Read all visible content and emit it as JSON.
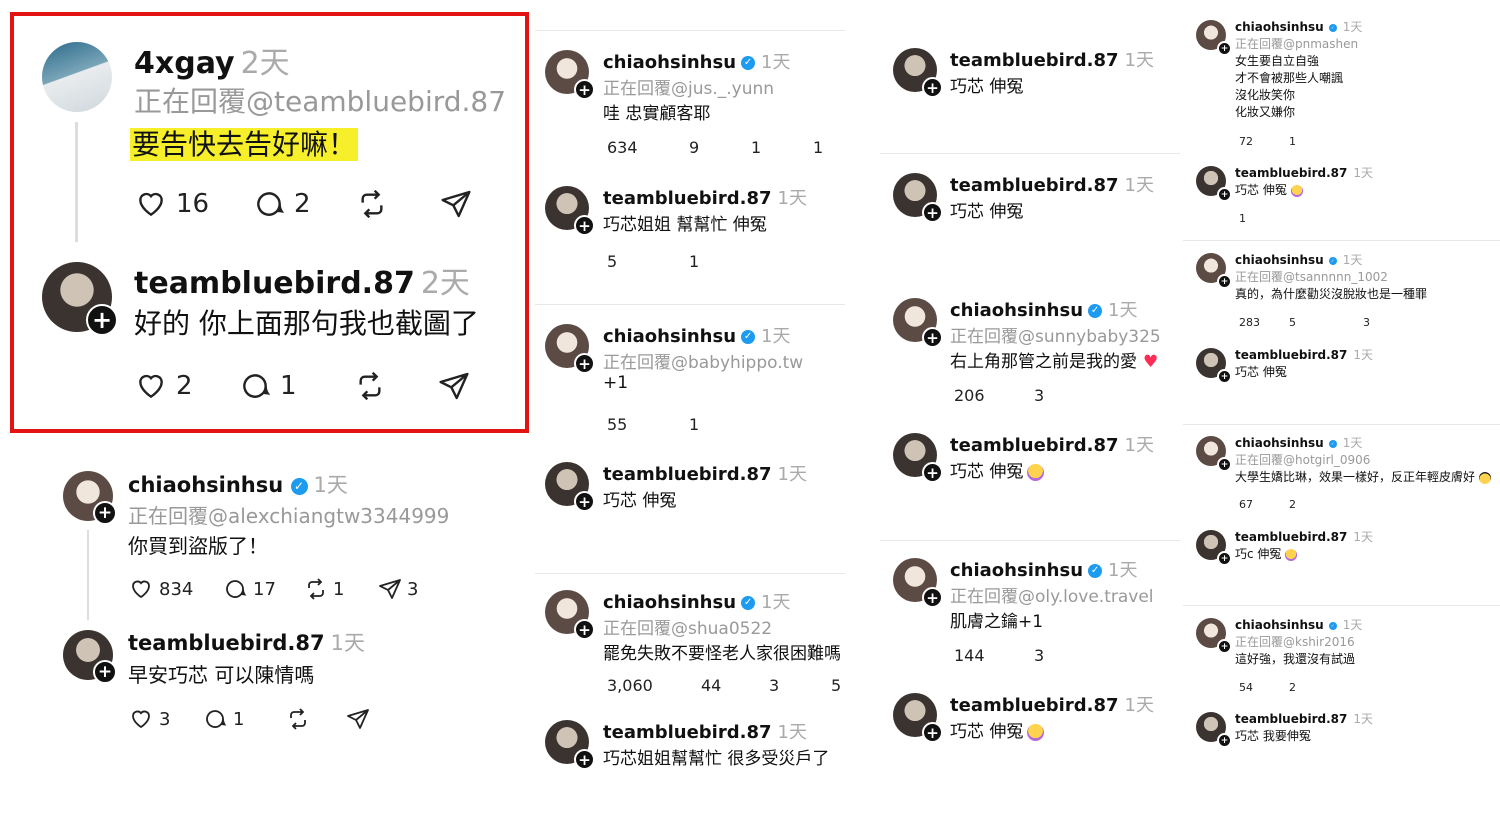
{
  "actions_icons": [
    "heart-icon",
    "comment-icon",
    "repost-icon",
    "share-icon"
  ],
  "col1": {
    "p1": {
      "user": "4xgay",
      "time": "2天",
      "reply": "正在回覆@teambluebird.87",
      "text": "要告快去告好嘛！",
      "likes": "16",
      "comments": "2"
    },
    "p2": {
      "user": "teambluebird.87",
      "time": "2天",
      "text": "好的 你上面那句我也截圖了",
      "likes": "2",
      "comments": "1"
    },
    "p3": {
      "user": "chiaohsinhsu",
      "time": "1天",
      "reply": "正在回覆@alexchiangtw3344999",
      "text": "你買到盜版了！",
      "likes": "834",
      "comments": "17",
      "reposts": "1",
      "shares": "3"
    },
    "p4": {
      "user": "teambluebird.87",
      "time": "1天",
      "text": "早安巧芯 可以陳情嗎",
      "likes": "3",
      "comments": "1"
    }
  },
  "col2": {
    "p1": {
      "user": "chiaohsinhsu",
      "time": "1天",
      "reply": "正在回覆@jus._.yunn",
      "text": "哇 忠實顧客耶",
      "likes": "634",
      "comments": "9",
      "reposts": "1",
      "shares": "1"
    },
    "p2": {
      "user": "teambluebird.87",
      "time": "1天",
      "text": "巧芯姐姐 幫幫忙 伸冤",
      "likes": "5",
      "comments": "1"
    },
    "p3": {
      "user": "chiaohsinhsu",
      "time": "1天",
      "reply": "正在回覆@babyhippo.tw",
      "text": "+1",
      "likes": "55",
      "comments": "1"
    },
    "p4": {
      "user": "teambluebird.87",
      "time": "1天",
      "text": "巧芯 伸冤"
    },
    "p5": {
      "user": "chiaohsinhsu",
      "time": "1天",
      "reply": "正在回覆@shua0522",
      "text": "罷免失敗不要怪老人家很困難嗎",
      "likes": "3,060",
      "comments": "44",
      "reposts": "3",
      "shares": "5"
    },
    "p6": {
      "user": "teambluebird.87",
      "time": "1天",
      "text": "巧芯姐姐幫幫忙 很多受災戶了"
    }
  },
  "col3": {
    "p1": {
      "user": "teambluebird.87",
      "time": "1天",
      "text": "巧芯 伸冤"
    },
    "p2": {
      "user": "teambluebird.87",
      "time": "1天",
      "text": "巧芯 伸冤"
    },
    "p3": {
      "user": "chiaohsinhsu",
      "time": "1天",
      "reply": "正在回覆@sunnybaby325",
      "text": "右上角那管之前是我的愛",
      "likes": "206",
      "comments": "3"
    },
    "p4": {
      "user": "teambluebird.87",
      "time": "1天",
      "text": "巧芯 伸冤"
    },
    "p5": {
      "user": "chiaohsinhsu",
      "time": "1天",
      "reply": "正在回覆@oly.love.travel",
      "text": "肌膚之鑰+1",
      "likes": "144",
      "comments": "3"
    },
    "p6": {
      "user": "teambluebird.87",
      "time": "1天",
      "text": "巧芯 伸冤"
    }
  },
  "col4": {
    "p1": {
      "user": "chiaohsinhsu",
      "time": "1天",
      "reply": "正在回覆@pnmashen",
      "lines": [
        "女生要自立自強",
        "才不會被那些人嘲諷",
        "沒化妝笑你",
        "化妝又嫌你"
      ],
      "likes": "72",
      "comments": "1"
    },
    "p2": {
      "user": "teambluebird.87",
      "time": "1天",
      "text": "巧芯 伸冤",
      "likes": "1"
    },
    "p3": {
      "user": "chiaohsinhsu",
      "time": "1天",
      "reply": "正在回覆@tsannnnn_1002",
      "text": "真的，為什麼勸災沒脫妝也是一種罪",
      "likes": "283",
      "comments": "5",
      "shares": "3"
    },
    "p4": {
      "user": "teambluebird.87",
      "time": "1天",
      "text": "巧芯 伸冤"
    },
    "p5": {
      "user": "chiaohsinhsu",
      "time": "1天",
      "reply": "正在回覆@hotgirl_0906",
      "text": "大學生嬌比琳，效果一樣好，反正年輕皮膚好",
      "likes": "67",
      "comments": "2"
    },
    "p6": {
      "user": "teambluebird.87",
      "time": "1天",
      "text": "巧c 伸冤"
    },
    "p7": {
      "user": "chiaohsinhsu",
      "time": "1天",
      "reply": "正在回覆@kshir2016",
      "text": "這好強，我還沒有試過",
      "likes": "54",
      "comments": "2"
    },
    "p8": {
      "user": "teambluebird.87",
      "time": "1天",
      "text": "巧芯 我要伸冤"
    }
  },
  "colors": {
    "highlight": "#f6ef2a",
    "frame": "#e31313",
    "verified": "#1d9bf0",
    "heart_emoji": "#ff2d55",
    "muted": "#999999"
  }
}
